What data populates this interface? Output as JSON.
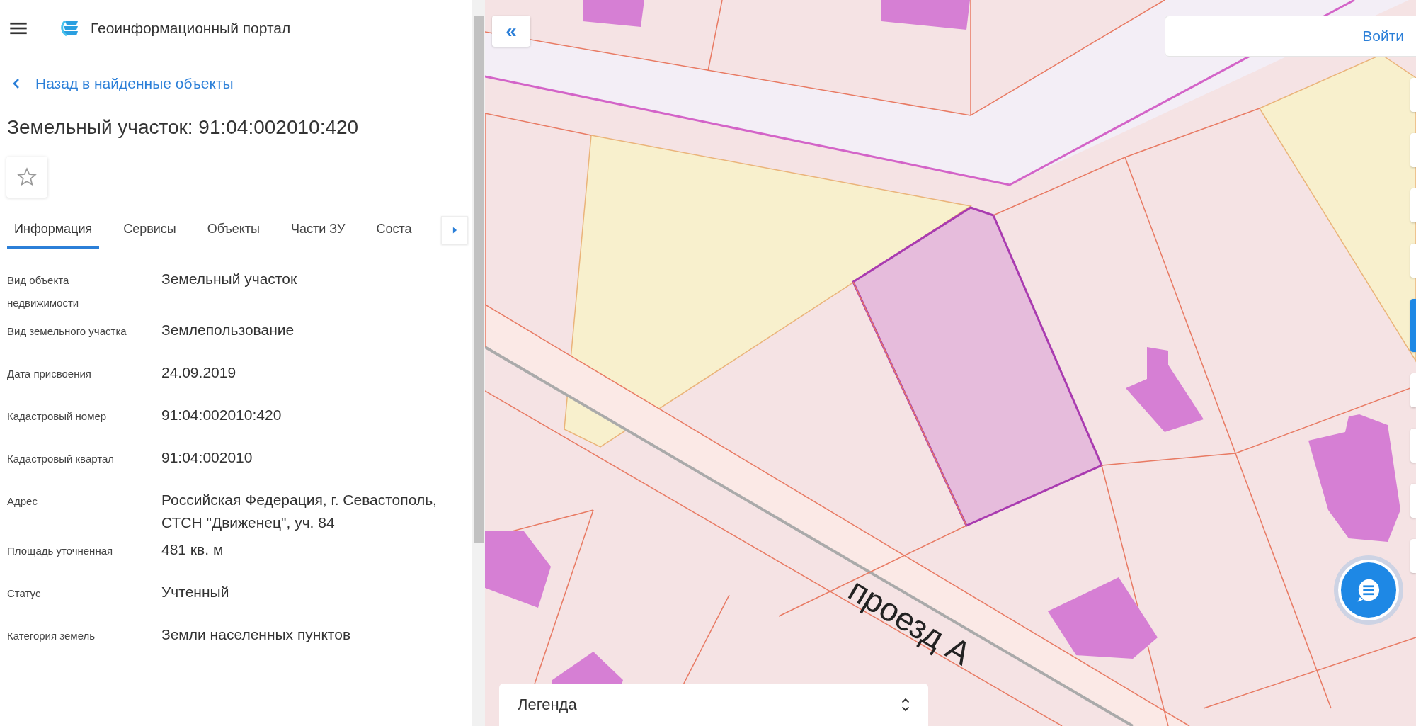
{
  "header": {
    "title": "Геоинформационный портал"
  },
  "back_link": "Назад в найденные объекты",
  "object_title": "Земельный участок: 91:04:002010:420",
  "tabs": [
    {
      "label": "Информация",
      "selected": true
    },
    {
      "label": "Сервисы",
      "selected": false
    },
    {
      "label": "Объекты",
      "selected": false
    },
    {
      "label": "Части ЗУ",
      "selected": false
    },
    {
      "label": "Соста",
      "selected": false
    }
  ],
  "fields": [
    {
      "label": "Вид объекта недвижимости",
      "value": "Земельный участок"
    },
    {
      "label": "Вид земельного участка",
      "value": "Землепользование"
    },
    {
      "label": "Дата присвоения",
      "value": "24.09.2019"
    },
    {
      "label": "Кадастровый номер",
      "value": "91:04:002010:420"
    },
    {
      "label": "Кадастровый квартал",
      "value": "91:04:002010"
    },
    {
      "label": "Адрес",
      "value": "Российская Федерация, г. Севастополь, СТСН \"Движенец\", уч. 84"
    },
    {
      "label": "Площадь уточненная",
      "value": "481 кв. м"
    },
    {
      "label": "Статус",
      "value": "Учтенный"
    },
    {
      "label": "Категория земель",
      "value": "Земли населенных пунктов"
    }
  ],
  "map": {
    "collapse_button": "«",
    "login_button": "Войти",
    "street_label": "проезд А",
    "legend": "Легенда"
  }
}
